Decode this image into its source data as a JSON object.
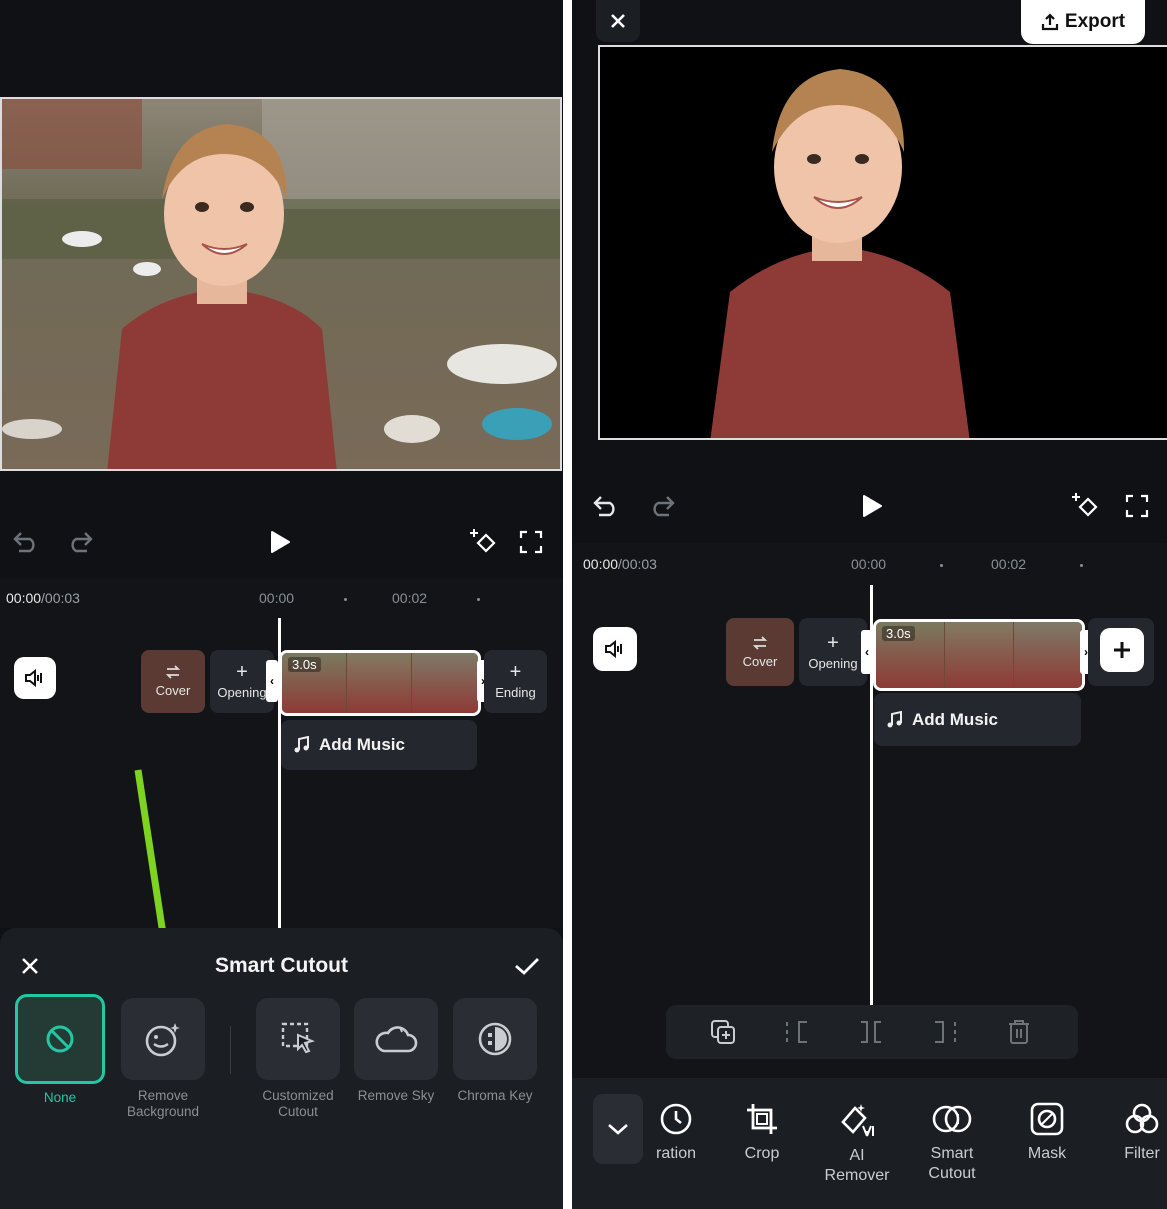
{
  "left": {
    "time_current": "00:00",
    "time_total": "/00:03",
    "ticks": [
      "00:00",
      "00:02"
    ],
    "chips": {
      "cover": "Cover",
      "opening": "Opening",
      "ending": "Ending",
      "plus": "+"
    },
    "clip_duration": "3.0s",
    "add_music": "Add Music",
    "sheet": {
      "title": "Smart Cutout",
      "options": [
        {
          "label": "None",
          "icon": "no-entry-icon"
        },
        {
          "label": "Remove Background",
          "icon": "sparkle-face-icon"
        },
        {
          "label": "Customized Cutout",
          "icon": "cursor-select-icon"
        },
        {
          "label": "Remove Sky",
          "icon": "cloud-icon"
        },
        {
          "label": "Chroma Key",
          "icon": "chroma-icon"
        }
      ]
    }
  },
  "right": {
    "export_label": "Export",
    "time_current": "00:00",
    "time_total": "/00:03",
    "ticks": [
      "00:00",
      "00:02"
    ],
    "chips": {
      "cover": "Cover",
      "opening": "Opening",
      "plus": "+"
    },
    "clip_duration": "3.0s",
    "add_music": "Add Music",
    "tools": [
      {
        "label": "ration",
        "icon": "clock-icon"
      },
      {
        "label": "Crop",
        "icon": "crop-icon"
      },
      {
        "label": "AI Remover",
        "icon": "eraser-ai-icon"
      },
      {
        "label": "Smart Cutout",
        "icon": "smart-cutout-icon"
      },
      {
        "label": "Mask",
        "icon": "mask-icon"
      },
      {
        "label": "Filter",
        "icon": "filter-icon"
      }
    ]
  },
  "colors": {
    "accent": "#22c7a4",
    "arrow": "#7ed321",
    "panel_bg": "#0f1115",
    "sheet_bg": "#1b1e23"
  }
}
